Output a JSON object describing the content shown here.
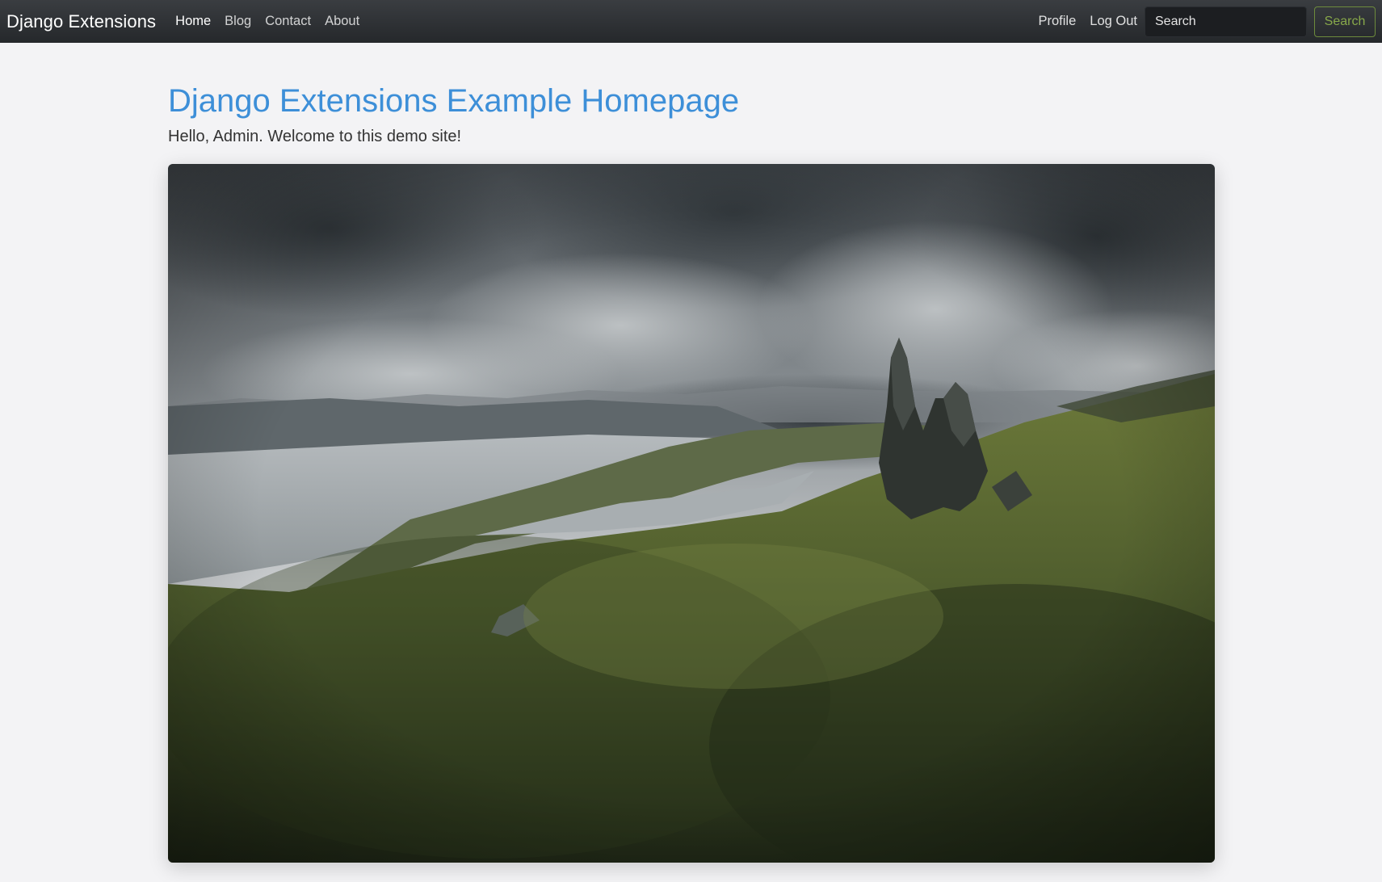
{
  "navbar": {
    "brand": "Django Extensions",
    "links": [
      {
        "label": "Home",
        "active": true
      },
      {
        "label": "Blog",
        "active": false
      },
      {
        "label": "Contact",
        "active": false
      },
      {
        "label": "About",
        "active": false
      }
    ],
    "right_links": [
      "Profile",
      "Log Out"
    ],
    "search": {
      "placeholder": "Search",
      "value": "",
      "button_label": "Search"
    }
  },
  "main": {
    "title": "Django Extensions Example Homepage",
    "subtitle": "Hello, Admin. Welcome to this demo site!",
    "hero_image_subject": "landscape-photo-rock-pinnacles-over-green-valley"
  },
  "colors": {
    "navbar_bg": "#2c2f33",
    "title": "#3d8fd8",
    "search_button": "#87a84a",
    "page_bg": "#f3f3f5"
  }
}
